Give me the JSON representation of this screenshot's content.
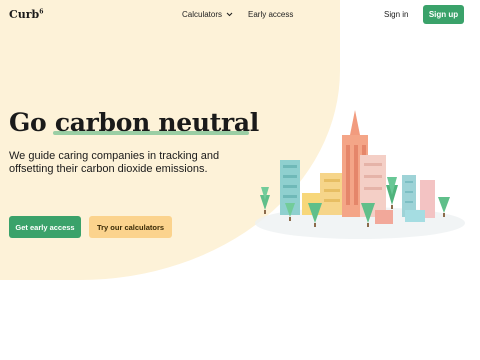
{
  "brand": {
    "name": "Curb",
    "superscript": "6"
  },
  "nav": {
    "calculators_label": "Calculators",
    "early_access_label": "Early access",
    "sign_in_label": "Sign in",
    "sign_up_label": "Sign up"
  },
  "hero": {
    "title": "Go carbon neutral",
    "subtitle": "We guide caring companies in tracking and offsetting their carbon dioxide emissions.",
    "primary_cta": "Get early access",
    "secondary_cta": "Try our calculators"
  },
  "colors": {
    "accent_green": "#3aa26a",
    "background_blob": "#fdf2d8",
    "secondary_button": "#fbd38d"
  },
  "icons": {
    "calculators_dropdown": "chevron-down-icon",
    "illustration": "city-buildings-illustration"
  }
}
